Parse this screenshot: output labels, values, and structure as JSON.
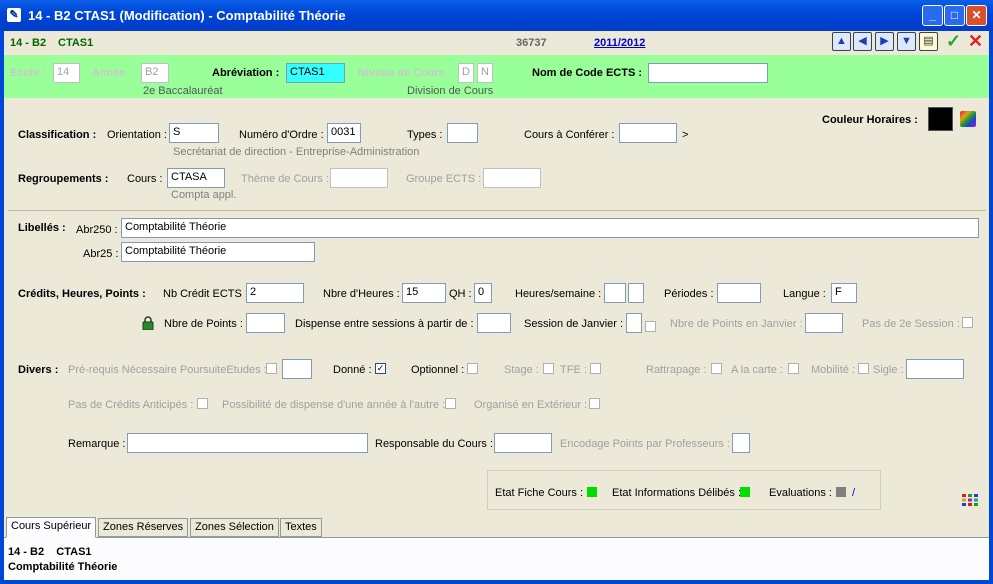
{
  "window": {
    "title": "14 - B2    CTAS1 (Modification) - Comptabilité Théorie",
    "minimize": "_",
    "maximize": "□",
    "close": "✕"
  },
  "infobar": {
    "code": "14 - B2",
    "course": "CTAS1",
    "id": "36737",
    "year": "2011/2012"
  },
  "nav": {
    "icons": [
      "nav-up-icon",
      "nav-left-icon",
      "nav-right-icon",
      "nav-down-icon",
      "document-icon"
    ],
    "ok": "✓",
    "cancel": "✕"
  },
  "header": {
    "ecole_label": "Ecole :",
    "ecole_value": "14",
    "annee_label": "Année :",
    "annee_value": "B2",
    "annee_desc": "2e Baccalauréat",
    "abrev_label": "Abréviation :",
    "abrev_value": "CTAS1",
    "niveau_label": "Niveau de Cours :",
    "niveau_v1": "D",
    "niveau_v2": "N",
    "niveau_desc": "Division de Cours",
    "ects_label": "Nom de Code ECTS :",
    "ects_value": ""
  },
  "couleur": {
    "label": "Couleur Horaires :",
    "color": "#000000"
  },
  "classification": {
    "label": "Classification :",
    "orientation_label": "Orientation :",
    "orientation_value": "S",
    "ordre_label": "Numéro d'Ordre :",
    "ordre_value": "0031",
    "types_label": "Types :",
    "types_value": "",
    "conferer_label": "Cours à Conférer :",
    "conferer_value": "",
    "conferer_suffix": ">",
    "desc": "Secrétariat de direction - Entreprise-Administration"
  },
  "regroupements": {
    "label": "Regroupements :",
    "cours_label": "Cours :",
    "cours_value": "CTASA",
    "cours_desc": "Compta appl.",
    "theme_label": "Thème de Cours :",
    "theme_value": "",
    "groupe_label": "Groupe ECTS :",
    "groupe_value": ""
  },
  "libelles": {
    "label": "Libellés :",
    "abr250_label": "Abr250 :",
    "abr250_value": "Comptabilité Théorie",
    "abr25_label": "Abr25 :",
    "abr25_value": "Comptabilité Théorie"
  },
  "credits": {
    "label": "Crédits, Heures, Points :",
    "nb_ects_label": "Nb Crédit ECTS :",
    "nb_ects_value": "2",
    "heures_label": "Nbre d'Heures :",
    "heures_value": "15",
    "qh_label": "QH :",
    "qh_value": "0",
    "hsem_label": "Heures/semaine :",
    "hsem_v1": "",
    "hsem_v2": "",
    "periodes_label": "Périodes :",
    "periodes_value": "",
    "langue_label": "Langue :",
    "langue_value": "F",
    "points_label": "Nbre de Points :",
    "points_value": "",
    "dispense_label": "Dispense entre sessions à partir de :",
    "dispense_value": "",
    "janvier_label": "Session de Janvier :",
    "janvier_value": "",
    "pts_janvier_label": "Nbre de Points en Janvier :",
    "pts_janvier_value": "",
    "pas2e_label": "Pas de 2e Session :"
  },
  "divers": {
    "label": "Divers :",
    "prerequis_label": "Pré-requis Nécessaire PoursuiteEtudes :",
    "donne_label": "Donné :",
    "donne_checked": "✓",
    "optionnel_label": "Optionnel :",
    "stage_label": "Stage :",
    "tfe_label": "TFE :",
    "rattrapage_label": "Rattrapage :",
    "carte_label": "A la carte :",
    "mobilite_label": "Mobilité :",
    "sigle_label": "Sigle :",
    "sigle_value": "",
    "anticipes_label": "Pas de Crédits Anticipés :",
    "dispense_annee_label": "Possibilité de dispense d'une année à l'autre :",
    "exterieur_label": "Organisé en Extérieur :"
  },
  "remarque": {
    "label": "Remarque :",
    "value": "",
    "responsable_label": "Responsable du Cours :",
    "responsable_value": "",
    "encodage_label": "Encodage Points par Professeurs :",
    "encodage_value": ""
  },
  "etat": {
    "fiche_label": "Etat Fiche Cours :",
    "fiche_color": "#00dd00",
    "delibes_label": "Etat Informations Délibés :",
    "delibes_color": "#00dd00",
    "eval_label": "Evaluations :",
    "eval_color": "#808080",
    "eval_suffix": "/"
  },
  "tabs": [
    "Cours Supérieur",
    "Zones Réserves",
    "Zones Sélection",
    "Textes"
  ],
  "footer": {
    "line1": "14 - B2    CTAS1",
    "line2": "Comptabilité Théorie"
  }
}
